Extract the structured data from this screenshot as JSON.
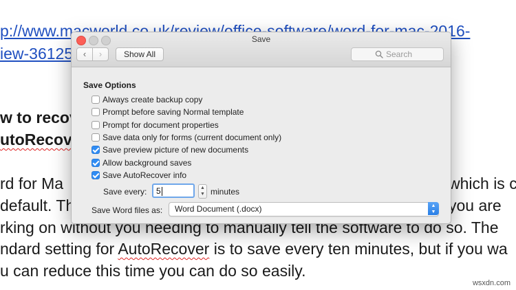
{
  "document": {
    "link_line1": "p://www.macworld.co.uk/review/office-software/word-for-mac-2016-",
    "link_line2": "iew-36125",
    "heading_line1": "w to recov",
    "heading_line2": "utoRecover",
    "body_line1_left": "rd for Ma",
    "body_line1_right": "which is c",
    "body_line2_left": "default. Th",
    "body_line2_right": "you are",
    "body_line3": "rking on without you needing to manually tell the software to do so. The",
    "body_line4_a": "ndard setting for ",
    "body_line4_b": "AutoRecover",
    "body_line4_c": " is to save every ten minutes, but if you wa",
    "body_line5": "u can reduce this time you can do so easily."
  },
  "watermark": "wsxdn.com",
  "dialog": {
    "title": "Save",
    "nav_back_glyph": "‹",
    "nav_forward_glyph": "›",
    "show_all_label": "Show All",
    "search_placeholder": "Search",
    "section_title": "Save Options",
    "options": [
      {
        "label": "Always create backup copy",
        "checked": false
      },
      {
        "label": "Prompt before saving Normal template",
        "checked": false
      },
      {
        "label": "Prompt for document properties",
        "checked": false
      },
      {
        "label": "Save data only for forms (current document only)",
        "checked": false
      },
      {
        "label": "Save preview picture of new documents",
        "checked": true
      },
      {
        "label": "Allow background saves",
        "checked": true
      },
      {
        "label": "Save AutoRecover info",
        "checked": true
      }
    ],
    "save_every_label": "Save every:",
    "save_every_value": "5",
    "minutes_label": "minutes",
    "save_as_label": "Save Word files as:",
    "save_as_value": "Word Document (.docx)"
  },
  "colors": {
    "accent": "#2f8cf4",
    "close_button": "#fc5f57",
    "link": "#1f4fc0"
  },
  "icons": {
    "search": "search-icon",
    "stepper": "stepper-icon",
    "dropdown": "chevron-updown-icon"
  }
}
